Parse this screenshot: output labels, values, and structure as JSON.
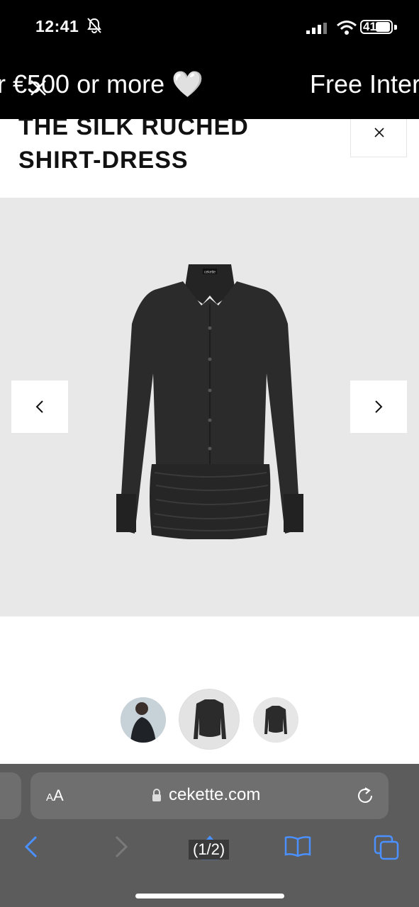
{
  "status_bar": {
    "time": "12:41",
    "battery": "41"
  },
  "promo": {
    "text_left": "r €500 or more 🤍",
    "text_right": "Free Intern"
  },
  "product": {
    "title_line1": "THE SILK RUCHED",
    "title_line2": "SHIRT-DRESS"
  },
  "gallery": {
    "dress_label": "cekette"
  },
  "browser": {
    "aa_label_small": "A",
    "aa_label": "A",
    "url": "cekette.com",
    "page_count": "(1/2)"
  },
  "colors": {
    "status_bg": "#000000",
    "gallery_bg": "#e8e8e8",
    "safari_bg": "#5c5c5c",
    "safari_accent": "#3b82f6"
  },
  "icons": [
    "bell-slash-icon",
    "signal-icon",
    "wifi-icon",
    "battery-icon",
    "close-icon",
    "chevron-left-icon",
    "chevron-right-icon",
    "lock-icon",
    "reload-icon",
    "back-icon",
    "forward-icon",
    "share-icon",
    "bookmarks-icon",
    "tabs-icon"
  ]
}
